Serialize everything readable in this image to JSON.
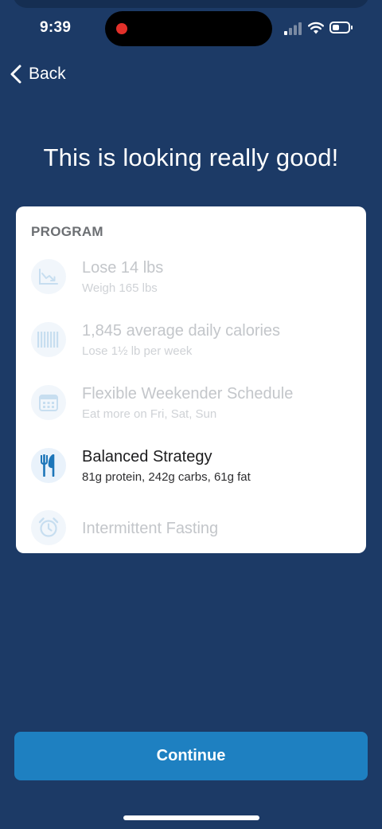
{
  "status": {
    "time": "9:39"
  },
  "nav": {
    "back_label": "Back"
  },
  "headline": "This is looking really good!",
  "program": {
    "title": "PROGRAM",
    "items": [
      {
        "icon": "weight-trend-icon",
        "title": "Lose 14 lbs",
        "subtitle": "Weigh 165 lbs",
        "active": false
      },
      {
        "icon": "calorie-bars-icon",
        "title": "1,845 average daily calories",
        "subtitle": "Lose 1½ lb per week",
        "active": false
      },
      {
        "icon": "calendar-icon",
        "title": "Flexible Weekender Schedule",
        "subtitle": "Eat more on Fri, Sat, Sun",
        "active": false
      },
      {
        "icon": "fork-knife-icon",
        "title": "Balanced Strategy",
        "subtitle": "81g protein, 242g carbs, 61g fat",
        "active": true
      },
      {
        "icon": "alarm-clock-icon",
        "title": "Intermittent Fasting",
        "subtitle": "",
        "active": false
      }
    ]
  },
  "continue_label": "Continue",
  "colors": {
    "background": "#1c3a66",
    "accent": "#1e80c1",
    "icon_muted": "#c7def0",
    "icon_active": "#1d76b9"
  }
}
